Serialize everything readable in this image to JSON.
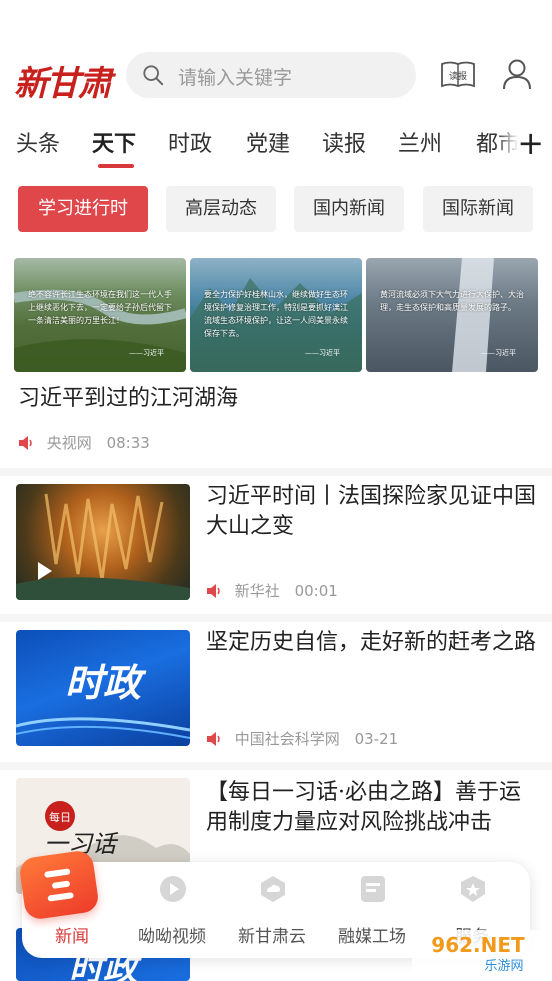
{
  "header": {
    "logo_text": "新甘肃",
    "search_placeholder": "请输入关键字",
    "read_icon_label": "读报"
  },
  "tabs": [
    "头条",
    "天下",
    "时政",
    "党建",
    "读报",
    "兰州",
    "都市"
  ],
  "active_tab": "天下",
  "chips": [
    "学习进行时",
    "高层动态",
    "国内新闻",
    "国际新闻"
  ],
  "active_chip": "学习进行时",
  "feed": [
    {
      "title": "习近平到过的江河湖海",
      "source": "央视网",
      "time": "08:33",
      "images": [
        {
          "caption": "绝不容许长江生态环境在我们这一代人手上继续恶化下去，一定要给子孙后代留下一条清洁美丽的万里长江！",
          "signature": "——习近平"
        },
        {
          "caption": "要全力保护好桂林山水，继续做好生态环境保护修复治理工作，特别是要抓好漓江流域生态环境保护，让这一人间美景永续保存下去。",
          "signature": "——习近平"
        },
        {
          "caption": "黄河流域必须下大气力进行大保护、大治理，走生态保护和高质量发展的路子。",
          "signature": "——习近平"
        }
      ]
    },
    {
      "title": "习近平时间丨法国探险家见证中国大山之变",
      "source": "新华社",
      "time": "00:01"
    },
    {
      "title": "坚定历史自信，走好新的赶考之路",
      "source": "中国社会科学网",
      "time": "03-21",
      "thumb_text": "时政"
    },
    {
      "title": "【每日一习话·必由之路】善于运用制度力量应对风险挑战冲击",
      "thumb_text_small": "每日",
      "thumb_text_big": "一习话"
    }
  ],
  "bottom_nav": [
    {
      "label": "新闻",
      "icon": "news-icon"
    },
    {
      "label": "呦呦视频",
      "icon": "video-icon"
    },
    {
      "label": "新甘肃云",
      "icon": "cloud-icon"
    },
    {
      "label": "融媒工场",
      "icon": "media-icon"
    },
    {
      "label": "服务",
      "icon": "service-icon"
    }
  ],
  "next_thumb_text": "时政",
  "watermark": {
    "number": "962.NET",
    "text": "乐游网"
  },
  "colors": {
    "accent": "#d9383a",
    "chip_active": "#e0474a",
    "logo": "#c8211d"
  }
}
